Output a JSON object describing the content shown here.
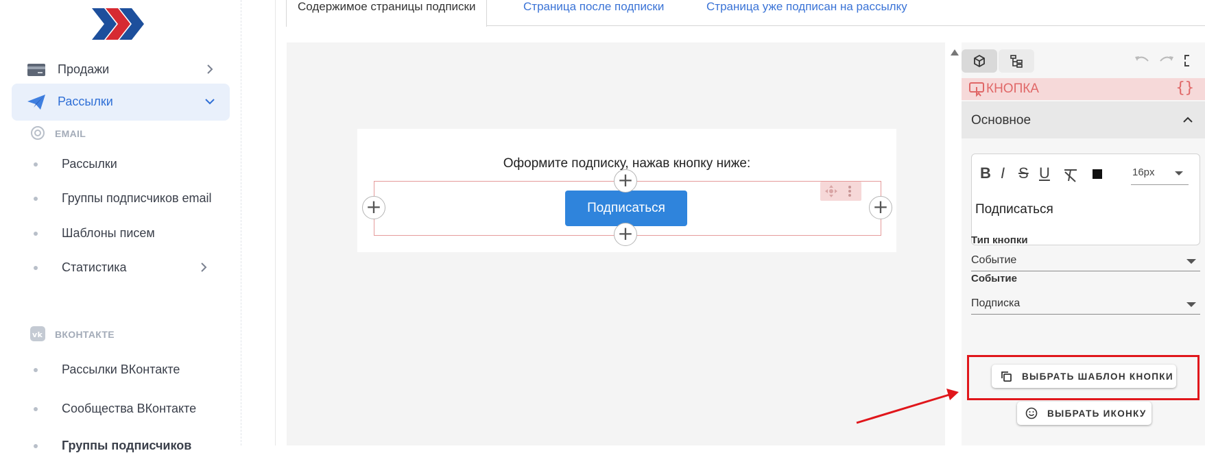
{
  "sidebar": {
    "items": [
      {
        "label": "Продажи",
        "icon": "card-icon"
      },
      {
        "label": "Рассылки",
        "icon": "paper-plane-icon"
      }
    ],
    "sections": {
      "email": {
        "label": "EMAIL",
        "icon": "at-icon"
      },
      "vk": {
        "label": "ВКОНТАКТЕ",
        "icon": "vk-icon"
      }
    },
    "email_items": [
      "Рассылки",
      "Группы подписчиков email",
      "Шаблоны писем",
      "Статистика"
    ],
    "vk_items": [
      "Рассылки ВКонтакте",
      "Сообщества ВКонтакте",
      "Группы подписчиков"
    ]
  },
  "tabs": [
    "Содержимое страницы подписки",
    "Страница после подписки",
    "Страница уже подписан на рассылку"
  ],
  "canvas": {
    "headline": "Оформите подписку, нажав кнопку ниже:",
    "button_label": "Подписаться"
  },
  "panel": {
    "block_title": "КНОПКА",
    "code_icon": "{}",
    "section_title": "Основное",
    "editor": {
      "font_size": "16px",
      "content": "Подписаться",
      "tools": [
        "B",
        "I",
        "S",
        "U"
      ]
    },
    "button_type_label": "Тип кнопки",
    "button_type_value": "Событие",
    "event_label": "Событие",
    "event_value": "Подписка",
    "choose_template": "ВЫБРАТЬ ШАБЛОН КНОПКИ",
    "choose_icon": "ВЫБРАТЬ ИКОНКУ"
  },
  "colors": {
    "accent": "#2f84dc",
    "sidebar_active": "#e9f0fb",
    "block_head": "#f6d9d9",
    "annotation": "#e0161b"
  }
}
